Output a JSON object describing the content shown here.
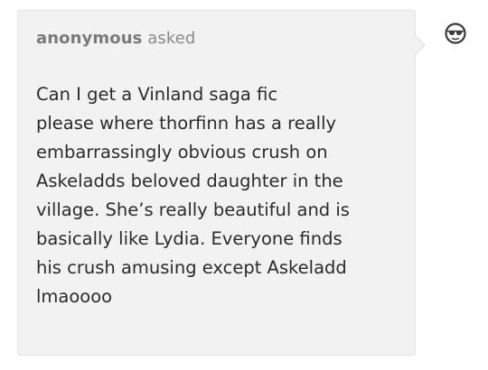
{
  "ask": {
    "asker": "anonymous",
    "verb": "asked",
    "lines": [
      "Can I get a Vinland saga fic",
      "please where thorfinn has a really",
      "embarrassingly obvious crush on",
      "Askeladds beloved daughter in the",
      "village. She’s really beautiful and is",
      "basically like Lydia. Everyone finds",
      "his crush amusing except Askeladd",
      "lmaoooo"
    ]
  },
  "avatar": {
    "icon": "anonymous-sunglasses-avatar-icon"
  }
}
